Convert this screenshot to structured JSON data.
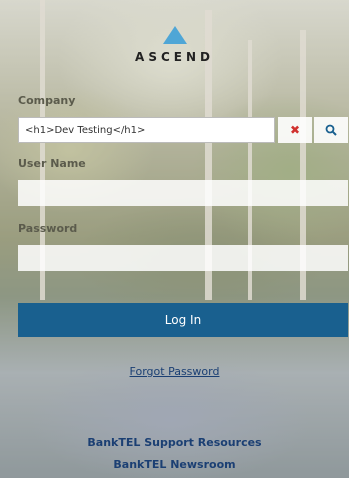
{
  "brand": {
    "logo_text": "ASCEND"
  },
  "form": {
    "company": {
      "label": "Company",
      "value": "<h1>Dev Testing</h1>",
      "clear_icon": "clear-icon",
      "search_icon": "search-icon"
    },
    "username": {
      "label": "User Name",
      "value": ""
    },
    "password": {
      "label": "Password",
      "value": ""
    },
    "login_label": "Log In"
  },
  "links": {
    "forgot_password": "Forgot Password",
    "support": "BankTEL Support Resources",
    "newsroom": "BankTEL Newsroom"
  },
  "colors": {
    "accent": "#19608f",
    "logo": "#4fa6d6",
    "clear": "#d0312d",
    "link": "#1b3f73"
  }
}
